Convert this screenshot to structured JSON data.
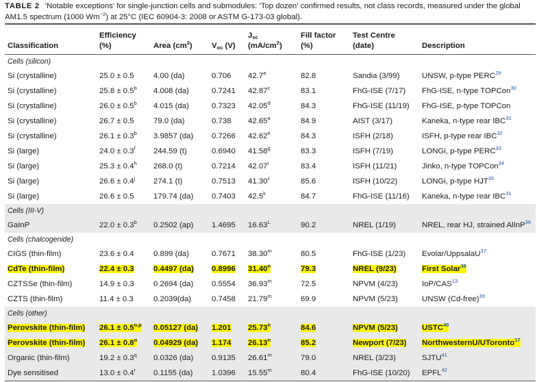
{
  "caption": {
    "label": "TABLE 2",
    "text_part1": "'Notable exceptions' for single-junction cells and submodules: 'Top dozen' confirmed results, not class records, measured under the global AM1.5 spectrum (1000 Wm",
    "text_sup": "−2",
    "text_part2": ") at 25°C (IEC 60904-3: 2008 or ASTM G-173-03 global)."
  },
  "headers": {
    "classification": "Classification",
    "efficiency_l1": "Efficiency",
    "efficiency_l2": "(%)",
    "area_main": "Area (cm",
    "area_sup": "2",
    "area_end": ")",
    "voc_main": "V",
    "voc_sub": "oc",
    "voc_unit": " (V)",
    "jsc_main": "J",
    "jsc_sub": "sc",
    "jsc_l2_main": "(mA/cm",
    "jsc_l2_sup": "2",
    "jsc_l2_end": ")",
    "ff_l1": "Fill factor",
    "ff_l2": "(%)",
    "tc_l1": "Test Centre",
    "tc_l2": "(date)",
    "description": "Description"
  },
  "rows": [
    {
      "type": "section",
      "label": "Cells (silicon)",
      "shade": false
    },
    {
      "type": "data",
      "shade": false,
      "highlight": false,
      "cls": "Si (crystalline)",
      "eff": "25.0 ± 0.5",
      "eff_sup": "",
      "area": "4.00 (da)",
      "voc": "0.706",
      "jsc": "42.7",
      "jsc_sup": "a",
      "ff": "82.8",
      "tc": "Sandia (3/99)",
      "desc": "UNSW, p-type PERC",
      "ref": "29"
    },
    {
      "type": "data",
      "shade": false,
      "highlight": false,
      "cls": "Si (crystalline)",
      "eff": "25.8 ± 0.5",
      "eff_sup": "b",
      "area": "4.008 (da)",
      "voc": "0.7241",
      "jsc": "42.87",
      "jsc_sup": "c",
      "ff": "83.1",
      "tc": "FhG-ISE (7/17)",
      "desc": "FhG-ISE, n-type TOPCon",
      "ref": "30"
    },
    {
      "type": "data",
      "shade": false,
      "highlight": false,
      "cls": "Si (crystalline)",
      "eff": "26.0 ± 0.5",
      "eff_sup": "b",
      "area": "4.015 (da)",
      "voc": "0.7323",
      "jsc": "42.05",
      "jsc_sup": "d",
      "ff": "84.3",
      "tc": "FhG-ISE (11/19)",
      "desc": "FhG-ISE, p-type TOPCon",
      "ref": ""
    },
    {
      "type": "data",
      "shade": false,
      "highlight": false,
      "cls": "Si (crystalline)",
      "eff": "26.7 ± 0.5",
      "eff_sup": "",
      "area": "79.0 (da)",
      "voc": "0.738",
      "jsc": "42.65",
      "jsc_sup": "a",
      "ff": "84.9",
      "tc": "AIST (3/17)",
      "desc": "Kaneka, n-type rear IBC",
      "ref": "31"
    },
    {
      "type": "data",
      "shade": false,
      "highlight": false,
      "cls": "Si (crystalline)",
      "eff": "26.1 ± 0.3",
      "eff_sup": "b",
      "area": "3.9857 (da)",
      "voc": "0.7266",
      "jsc": "42.62",
      "jsc_sup": "e",
      "ff": "84.3",
      "tc": "ISFH (2/18)",
      "desc": "ISFH, p-type rear IBC",
      "ref": "32"
    },
    {
      "type": "data",
      "shade": false,
      "highlight": false,
      "cls": "Si (large)",
      "eff": "24.0 ± 0.3",
      "eff_sup": "f",
      "area": "244.59 (t)",
      "voc": "0.6940",
      "jsc": "41.58",
      "jsc_sup": "g",
      "ff": "83.3",
      "tc": "ISFH (7/19)",
      "desc": "LONGi, p-type PERC",
      "ref": "33"
    },
    {
      "type": "data",
      "shade": false,
      "highlight": false,
      "cls": "Si (large)",
      "eff": "25.3 ± 0.4",
      "eff_sup": "h",
      "area": "268.0 (t)",
      "voc": "0.7214",
      "jsc": "42.07",
      "jsc_sup": "i",
      "ff": "83.4",
      "tc": "ISFH (11/21)",
      "desc": "Jinko, n-type TOPCon",
      "ref": "34"
    },
    {
      "type": "data",
      "shade": false,
      "highlight": false,
      "cls": "Si (large)",
      "eff": "26.6 ± 0.4",
      "eff_sup": "j",
      "area": "274.1 (t)",
      "voc": "0.7513",
      "jsc": "41.30",
      "jsc_sup": "c",
      "ff": "85.6",
      "tc": "ISFH (10/22)",
      "desc": "LONGi, p-type HJT",
      "ref": "35"
    },
    {
      "type": "data",
      "shade": false,
      "highlight": false,
      "cls": "Si (large)",
      "eff": "26.6 ± 0.5",
      "eff_sup": "",
      "area": "179.74 (da)",
      "voc": "0.7403",
      "jsc": "42.5",
      "jsc_sup": "k",
      "ff": "84.7",
      "tc": "FhG-ISE (11/16)",
      "desc": "Kaneka, n-type rear IBC",
      "ref": "31"
    },
    {
      "type": "section",
      "label": "Cells (III-V)",
      "shade": true
    },
    {
      "type": "data",
      "shade": true,
      "highlight": false,
      "cls": "GaInP",
      "eff": "22.0 ± 0.3",
      "eff_sup": "b",
      "area": "0.2502 (ap)",
      "voc": "1.4695",
      "jsc": "16.63",
      "jsc_sup": "L",
      "ff": "90.2",
      "tc": "NREL (1/19)",
      "desc": "NREL, rear HJ, strained AlInP",
      "ref": "36"
    },
    {
      "type": "section",
      "label": "Cells (chalcogenide)",
      "shade": false
    },
    {
      "type": "data",
      "shade": false,
      "highlight": false,
      "cls": "CIGS (thin-film)",
      "eff": "23.6 ± 0.4",
      "eff_sup": "",
      "area": "0.899 (da)",
      "voc": "0.7671",
      "jsc": "38.30",
      "jsc_sup": "m",
      "ff": "80.5",
      "tc": "FhG-ISE (1/23)",
      "desc": "Evolar/UppsalaU",
      "ref": "37"
    },
    {
      "type": "data",
      "shade": false,
      "highlight": true,
      "cls": "CdTe (thin-film)",
      "eff": "22.4 ± 0.3",
      "eff_sup": "",
      "area": "0.4497 (da)",
      "voc": "0.8996",
      "jsc": "31.40",
      "jsc_sup": "n",
      "ff": "79.3",
      "tc": "NREL (9/23)",
      "desc": "First Solar",
      "ref": "38"
    },
    {
      "type": "data",
      "shade": false,
      "highlight": false,
      "cls": "CZTSSe (thin-film)",
      "eff": "14.9 ± 0.3",
      "eff_sup": "",
      "area": "0.2694 (da)",
      "voc": "0.5554",
      "jsc": "36.93",
      "jsc_sup": "m",
      "ff": "72.5",
      "tc": "NPVM (4/23)",
      "desc": "IoP/CAS",
      "ref": "13"
    },
    {
      "type": "data",
      "shade": false,
      "highlight": false,
      "cls": "CZTS (thin-film)",
      "eff": "11.4 ± 0.3",
      "eff_sup": "",
      "area": "0.2039(da)",
      "voc": "0.7458",
      "jsc": "21.79",
      "jsc_sup": "m",
      "ff": "69.9",
      "tc": "NPVM (5/23)",
      "desc": "UNSW (Cd-free)",
      "ref": "39"
    },
    {
      "type": "section",
      "label": "Cells (other)",
      "shade": true
    },
    {
      "type": "data",
      "shade": true,
      "highlight": true,
      "cls": "Perovskite (thin-film)",
      "eff": "26.1 ± 0.5",
      "eff_sup": "o,p",
      "area": "0.05127 (da)",
      "voc": "1.201",
      "jsc": "25.73",
      "jsc_sup": "n",
      "ff": "84.6",
      "tc": "NPVM (5/23)",
      "desc": "USTC",
      "ref": "40"
    },
    {
      "type": "data",
      "shade": true,
      "highlight": true,
      "cls": "Perovskite (thin-film)",
      "eff": "26.1 ± 0.8",
      "eff_sup": "o",
      "area": "0.04929 (da)",
      "voc": "1.174",
      "jsc": "26.13",
      "jsc_sup": "n",
      "ff": "85.2",
      "tc": "Newport (7/23)",
      "desc": "NorthwesternU/UToronto",
      "ref": "17"
    },
    {
      "type": "data",
      "shade": true,
      "highlight": false,
      "cls": "Organic (thin-film)",
      "eff": "19.2 ± 0.3",
      "eff_sup": "q",
      "area": "0.0326 (da)",
      "voc": "0.9135",
      "jsc": "26.61",
      "jsc_sup": "m",
      "ff": "79.0",
      "tc": "NREL (3/23)",
      "desc": "SJTU",
      "ref": "41"
    },
    {
      "type": "data",
      "shade": true,
      "highlight": false,
      "cls": "Dye sensitised",
      "eff": "13.0 ± 0.4",
      "eff_sup": "r",
      "area": "0.1155 (da)",
      "voc": "1.0396",
      "jsc": "15.55",
      "jsc_sup": "m",
      "ff": "80.4",
      "tc": "FhG-ISE (10/20)",
      "desc": "EPFL",
      "ref": "42"
    }
  ],
  "colors": {
    "highlight": "#fff70a",
    "shade": "#e9e9ea",
    "ref_link": "#1f4ea8"
  }
}
